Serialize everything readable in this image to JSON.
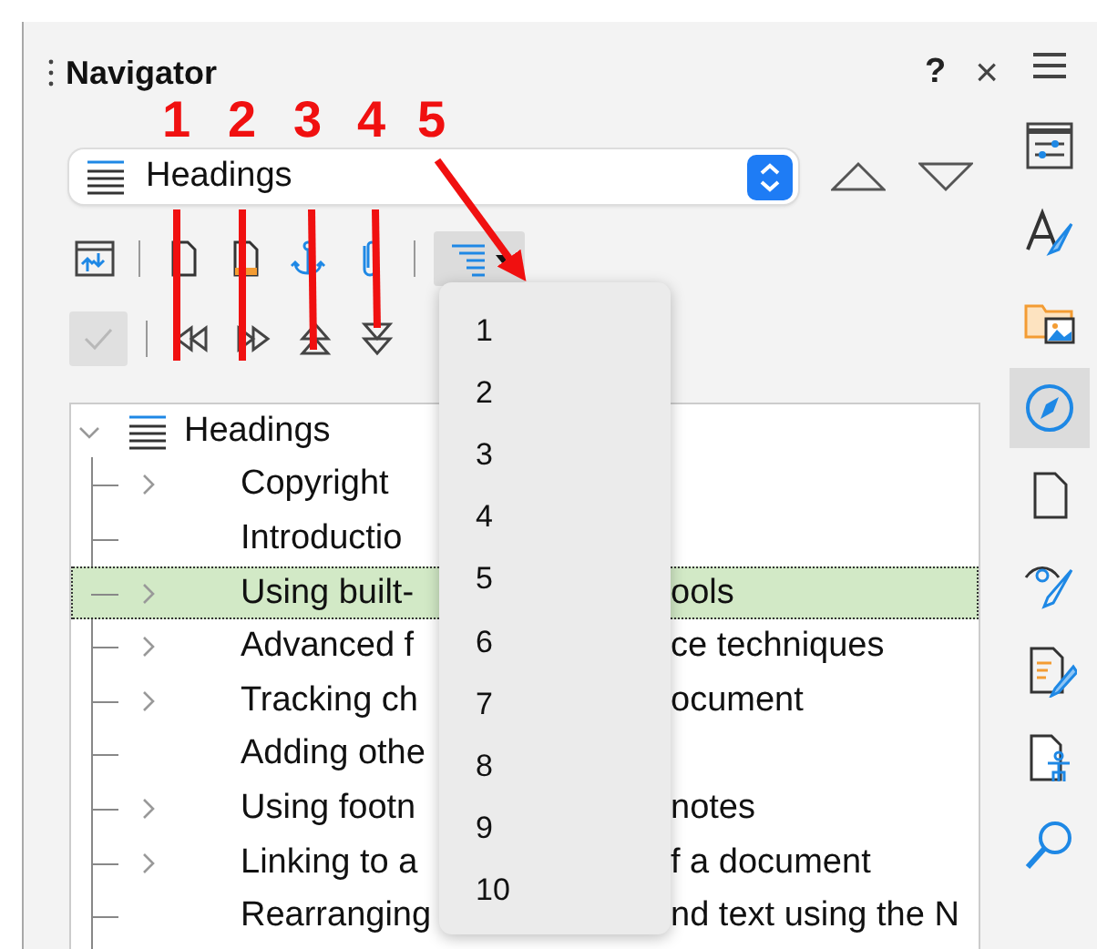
{
  "panel": {
    "title": "Navigator",
    "help": "?",
    "close": "×"
  },
  "content_combo": {
    "value": "Headings"
  },
  "toolbar_1": [
    {
      "kind": "promote-doc",
      "pressed": false
    },
    {
      "kind": "page",
      "pressed": false
    },
    {
      "kind": "header",
      "pressed": false
    },
    {
      "kind": "anchor",
      "pressed": false
    },
    {
      "kind": "clip",
      "pressed": false
    },
    {
      "kind": "heading-levels",
      "pressed": true
    }
  ],
  "toolbar_2": [
    {
      "kind": "check",
      "disabled": true
    },
    {
      "kind": "promote-chapter",
      "disabled": false
    },
    {
      "kind": "demote-chapter",
      "disabled": false
    },
    {
      "kind": "promote-level",
      "disabled": false
    },
    {
      "kind": "demote-level",
      "disabled": false
    }
  ],
  "tree": {
    "root": {
      "label": "Headings",
      "expanded": true
    },
    "children": [
      {
        "kind": "branch",
        "selected": false,
        "text_left": "Copyright"
      },
      {
        "kind": "leaf",
        "selected": false,
        "text_left": "Introductio"
      },
      {
        "kind": "branch",
        "selected": true,
        "text_left": "Using built-",
        "text_right": "ools"
      },
      {
        "kind": "branch",
        "selected": false,
        "text_left": "Advanced f",
        "text_right": "ce techniques"
      },
      {
        "kind": "branch",
        "selected": false,
        "text_left": "Tracking ch",
        "text_right": "ocument"
      },
      {
        "kind": "leaf",
        "selected": false,
        "text_left": "Adding othe"
      },
      {
        "kind": "branch",
        "selected": false,
        "text_left": "Using footn",
        "text_right": "notes"
      },
      {
        "kind": "branch",
        "selected": false,
        "text_left": "Linking to a",
        "text_right": "f a document"
      },
      {
        "kind": "leaf",
        "selected": false,
        "text_left": "Rearranging",
        "text_right": "nd text using the N"
      }
    ]
  },
  "heading_level_menu": [
    "1",
    "2",
    "3",
    "4",
    "5",
    "6",
    "7",
    "8",
    "9",
    "10"
  ],
  "annotations": [
    {
      "label": "1"
    },
    {
      "label": "2"
    },
    {
      "label": "3"
    },
    {
      "label": "4"
    },
    {
      "label": "5"
    }
  ],
  "sidebar": [
    {
      "kind": "properties",
      "selected": false
    },
    {
      "kind": "styles",
      "selected": false
    },
    {
      "kind": "gallery",
      "selected": false
    },
    {
      "kind": "navigator",
      "selected": true
    },
    {
      "kind": "page",
      "selected": false
    },
    {
      "kind": "style-inspector",
      "selected": false
    },
    {
      "kind": "manage-changes",
      "selected": false
    },
    {
      "kind": "accessibility",
      "selected": false
    },
    {
      "kind": "find",
      "selected": false
    }
  ]
}
